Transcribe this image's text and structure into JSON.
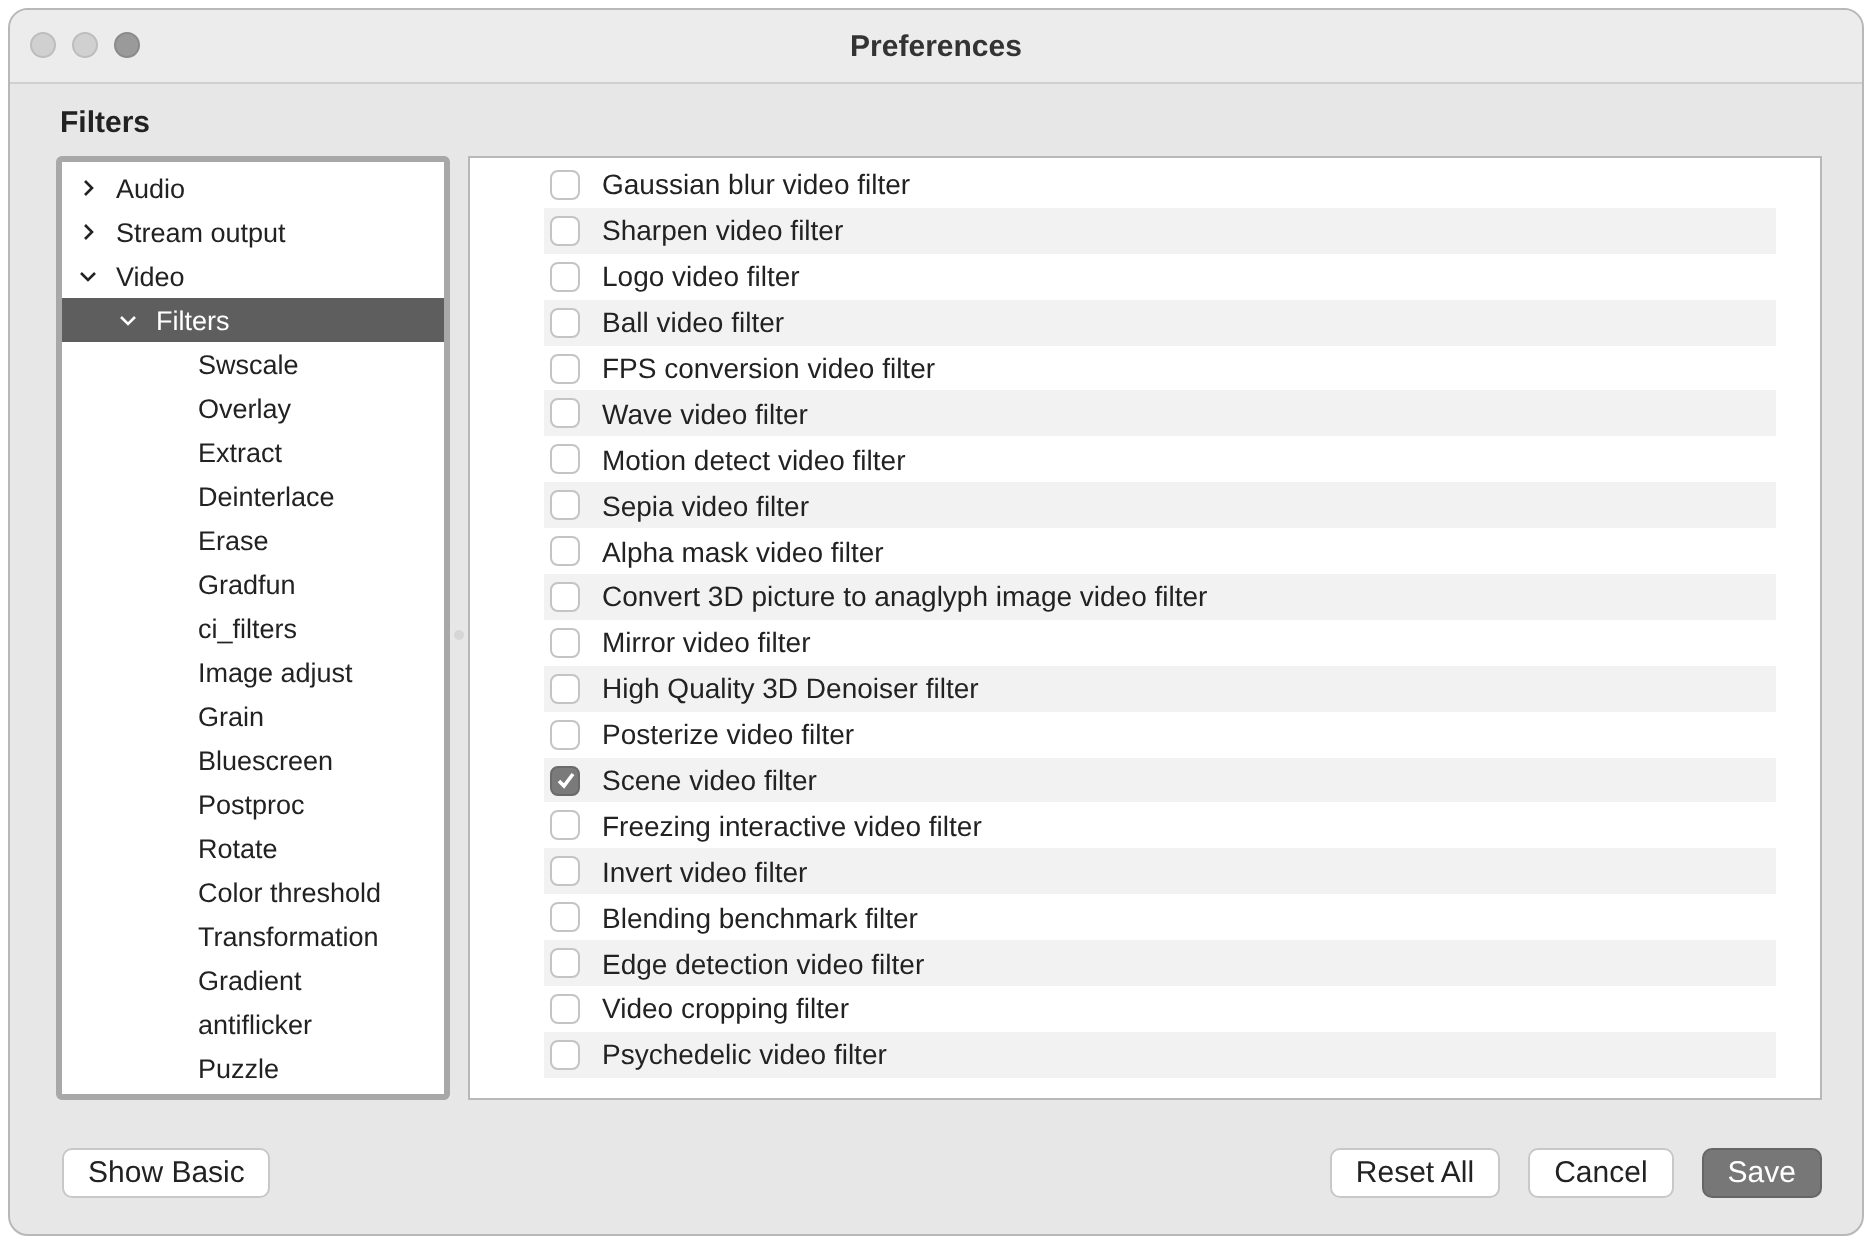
{
  "window": {
    "title": "Preferences"
  },
  "heading": "Filters",
  "tree": [
    {
      "label": "Audio",
      "expanded": false,
      "selected": false
    },
    {
      "label": "Stream output",
      "expanded": false,
      "selected": false
    },
    {
      "label": "Video",
      "expanded": true,
      "selected": false,
      "children": [
        {
          "label": "Filters",
          "expanded": true,
          "selected": true,
          "children": [
            {
              "label": "Swscale",
              "selected": false
            },
            {
              "label": "Overlay",
              "selected": false
            },
            {
              "label": "Extract",
              "selected": false
            },
            {
              "label": "Deinterlace",
              "selected": false
            },
            {
              "label": "Erase",
              "selected": false
            },
            {
              "label": "Gradfun",
              "selected": false
            },
            {
              "label": "ci_filters",
              "selected": false
            },
            {
              "label": "Image adjust",
              "selected": false
            },
            {
              "label": "Grain",
              "selected": false
            },
            {
              "label": "Bluescreen",
              "selected": false
            },
            {
              "label": "Postproc",
              "selected": false
            },
            {
              "label": "Rotate",
              "selected": false
            },
            {
              "label": "Color threshold",
              "selected": false
            },
            {
              "label": "Transformation",
              "selected": false
            },
            {
              "label": "Gradient",
              "selected": false
            },
            {
              "label": "antiflicker",
              "selected": false
            },
            {
              "label": "Puzzle",
              "selected": false
            }
          ]
        }
      ]
    }
  ],
  "filters": [
    {
      "label": "Gaussian blur video filter",
      "checked": false
    },
    {
      "label": "Sharpen video filter",
      "checked": false
    },
    {
      "label": "Logo video filter",
      "checked": false
    },
    {
      "label": "Ball video filter",
      "checked": false
    },
    {
      "label": "FPS conversion video filter",
      "checked": false
    },
    {
      "label": "Wave video filter",
      "checked": false
    },
    {
      "label": "Motion detect video filter",
      "checked": false
    },
    {
      "label": "Sepia video filter",
      "checked": false
    },
    {
      "label": "Alpha mask video filter",
      "checked": false
    },
    {
      "label": "Convert 3D picture to anaglyph image video filter",
      "checked": false
    },
    {
      "label": "Mirror video filter",
      "checked": false
    },
    {
      "label": "High Quality 3D Denoiser filter",
      "checked": false
    },
    {
      "label": "Posterize video filter",
      "checked": false
    },
    {
      "label": "Scene video filter",
      "checked": true
    },
    {
      "label": "Freezing interactive video filter",
      "checked": false
    },
    {
      "label": "Invert video filter",
      "checked": false
    },
    {
      "label": "Blending benchmark filter",
      "checked": false
    },
    {
      "label": "Edge detection video filter",
      "checked": false
    },
    {
      "label": "Video cropping filter",
      "checked": false
    },
    {
      "label": "Psychedelic video filter",
      "checked": false
    }
  ],
  "buttons_left": [
    {
      "label": "Show Basic",
      "default": false
    }
  ],
  "buttons_right": [
    {
      "label": "Reset All",
      "default": false
    },
    {
      "label": "Cancel",
      "default": false
    },
    {
      "label": "Save",
      "default": true
    }
  ]
}
